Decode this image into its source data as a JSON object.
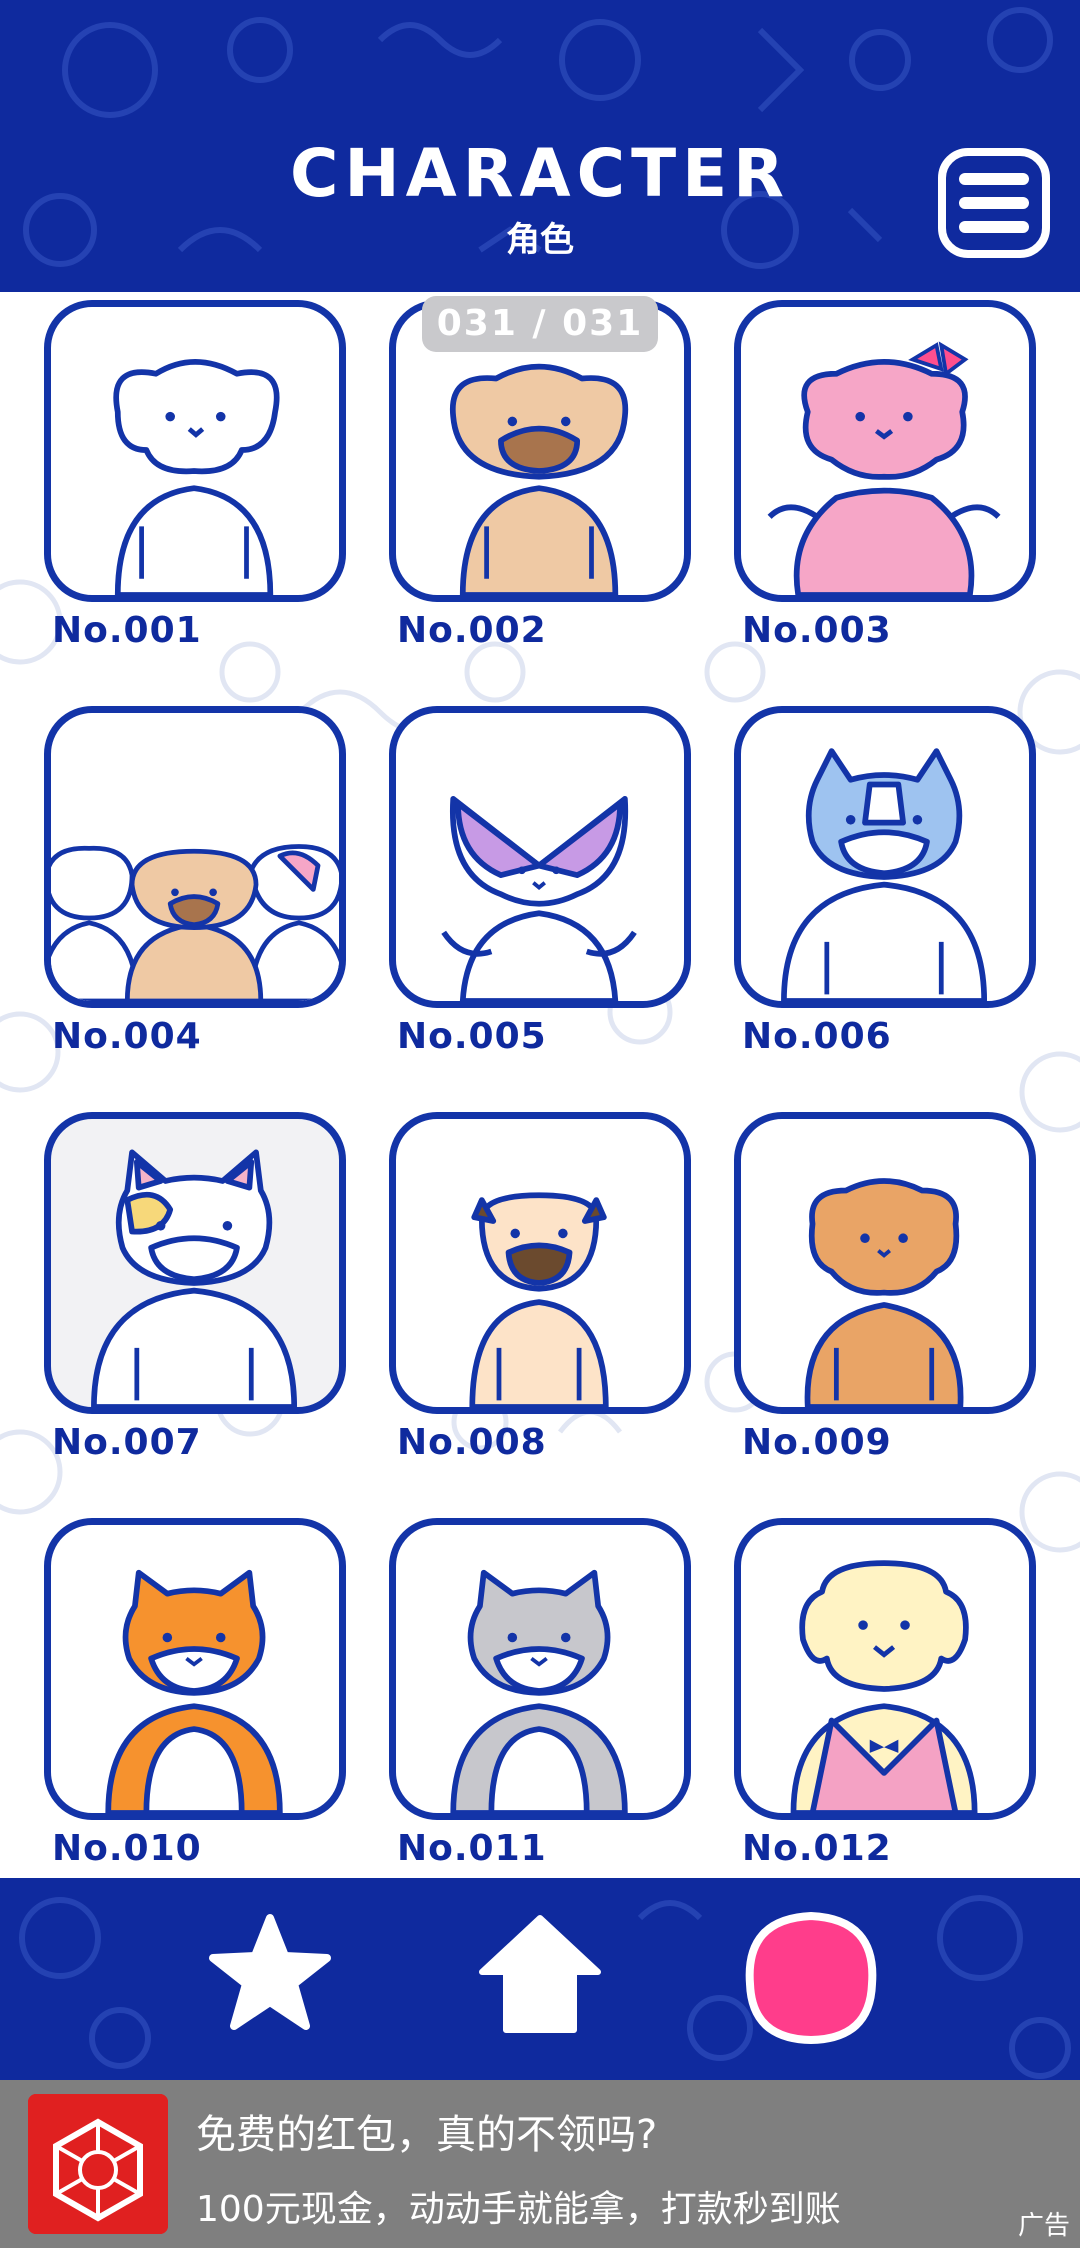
{
  "header": {
    "title": "CHARACTER",
    "subtitle": "角色"
  },
  "page_counter": "031 / 031",
  "characters": [
    {
      "label": "No.001",
      "icon": "white-maltese-dog-icon"
    },
    {
      "label": "No.002",
      "icon": "tan-pug-dog-icon"
    },
    {
      "label": "No.003",
      "icon": "pink-poodle-dog-icon"
    },
    {
      "label": "No.004",
      "icon": "three-puppies-group-icon"
    },
    {
      "label": "No.005",
      "icon": "papillon-dog-icon"
    },
    {
      "label": "No.006",
      "icon": "blue-boston-terrier-icon"
    },
    {
      "label": "No.007",
      "icon": "french-bulldog-icon"
    },
    {
      "label": "No.008",
      "icon": "black-mask-pug-icon"
    },
    {
      "label": "No.009",
      "icon": "brown-pekingese-dog-icon"
    },
    {
      "label": "No.010",
      "icon": "orange-shiba-inu-icon"
    },
    {
      "label": "No.011",
      "icon": "grey-shiba-inu-icon"
    },
    {
      "label": "No.012",
      "icon": "golden-retriever-vest-icon"
    }
  ],
  "bottom_nav": [
    {
      "icon": "star-icon"
    },
    {
      "icon": "home-icon"
    },
    {
      "icon": "pink-character-icon",
      "selected": true
    }
  ],
  "ad": {
    "title": "免费的红包，真的不领吗?",
    "description": "100元现金，动动手就能拿，打款秒到账",
    "tag": "广告"
  },
  "colors": {
    "navy": "#0f2a9e",
    "outline": "#1334a8",
    "accent_pink": "#ff3d8b",
    "ad_bg": "#7f7f7f",
    "ad_red": "#e02020"
  }
}
